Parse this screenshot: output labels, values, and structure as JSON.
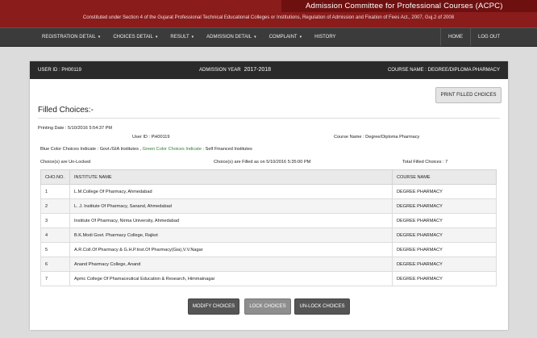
{
  "header": {
    "title": "Admission Committee for Professional Courses (ACPC)",
    "subtitle": "Constituted under Section 4 of the Gujarat Professional Technical Educational Colleges or Institutions, Regulation of Admission and Fixation of Fees Act., 2007, Guj.2 of 2008"
  },
  "nav": {
    "left": [
      {
        "label": "REGISTRATION DETAIL",
        "caret": "▾"
      },
      {
        "label": "CHOICES DETAIL",
        "caret": "▾"
      },
      {
        "label": "RESULT",
        "caret": "▾"
      },
      {
        "label": "ADMISSION DETAIL",
        "caret": "▾"
      },
      {
        "label": "COMPLAINT",
        "caret": "▾"
      },
      {
        "label": "HISTORY",
        "caret": ""
      }
    ],
    "right": [
      {
        "label": "HOME"
      },
      {
        "label": "LOG OUT"
      }
    ]
  },
  "panel_header": {
    "user_id": "USER ID : PH00119",
    "admission_year_label": "ADMISSION YEAR",
    "admission_year": "2017-2018",
    "course": "COURSE NAME : DEGREE/DIPLOMA PHARMACY"
  },
  "print_button": "PRINT FILLED CHOICES",
  "filled_title": "Filled Choices:-",
  "info": {
    "printing_date": "Printing Date : 5/10/2016 5:54:37 PM",
    "user_id": "User ID : PH00119",
    "course_name": "Course Name : Degree/Diploma Pharmacy",
    "legend_blue": "Blue Color Choices Indicate : Govt./GIA Institutes ,",
    "legend_green": "Green Color Choices Indicate :",
    "legend_green_value": "Self Financed Institutes",
    "status": "Choice(s) are Un-Locked",
    "filled_on": "Choice(s) are Filled as on 5/10/2016 5:35:00 PM",
    "total": "Total Filled Choices : 7"
  },
  "table": {
    "headers": [
      "CHO.NO.",
      "INSTITUTE NAME",
      "COURSE NAME"
    ],
    "rows": [
      [
        "1",
        "L.M.College Of Pharmacy, Ahmedabad",
        "DEGREE PHARMACY"
      ],
      [
        "2",
        "L. J. Institute Of Pharmacy, Sanand, Ahmedabad",
        "DEGREE PHARMACY"
      ],
      [
        "3",
        "Institute Of Pharmacy, Nirma University, Ahmedabad",
        "DEGREE PHARMACY"
      ],
      [
        "4",
        "B.K.Modi Govt. Pharmacy College, Rajkot",
        "DEGREE PHARMACY"
      ],
      [
        "5",
        "A.R.Coll.Of Pharmacy & G.H.P.Inst.Of Pharmacy(Gia),V.V.Nagar",
        "DEGREE PHARMACY"
      ],
      [
        "6",
        "Anand Pharmacy College, Anand",
        "DEGREE PHARMACY"
      ],
      [
        "7",
        "Apmc College Of Phamaceutical Education & Research, Himmatnagar",
        "DEGREE PHARMACY"
      ]
    ]
  },
  "buttons": {
    "modify": "MODIFY CHOICES",
    "lock": "LOCK CHOICES",
    "unlock": "UN-LOCK CHOICES"
  },
  "colors": {
    "banner": "#8a1c1c",
    "navbar": "#3b3b3b",
    "panel_header": "#2a2a2a"
  }
}
